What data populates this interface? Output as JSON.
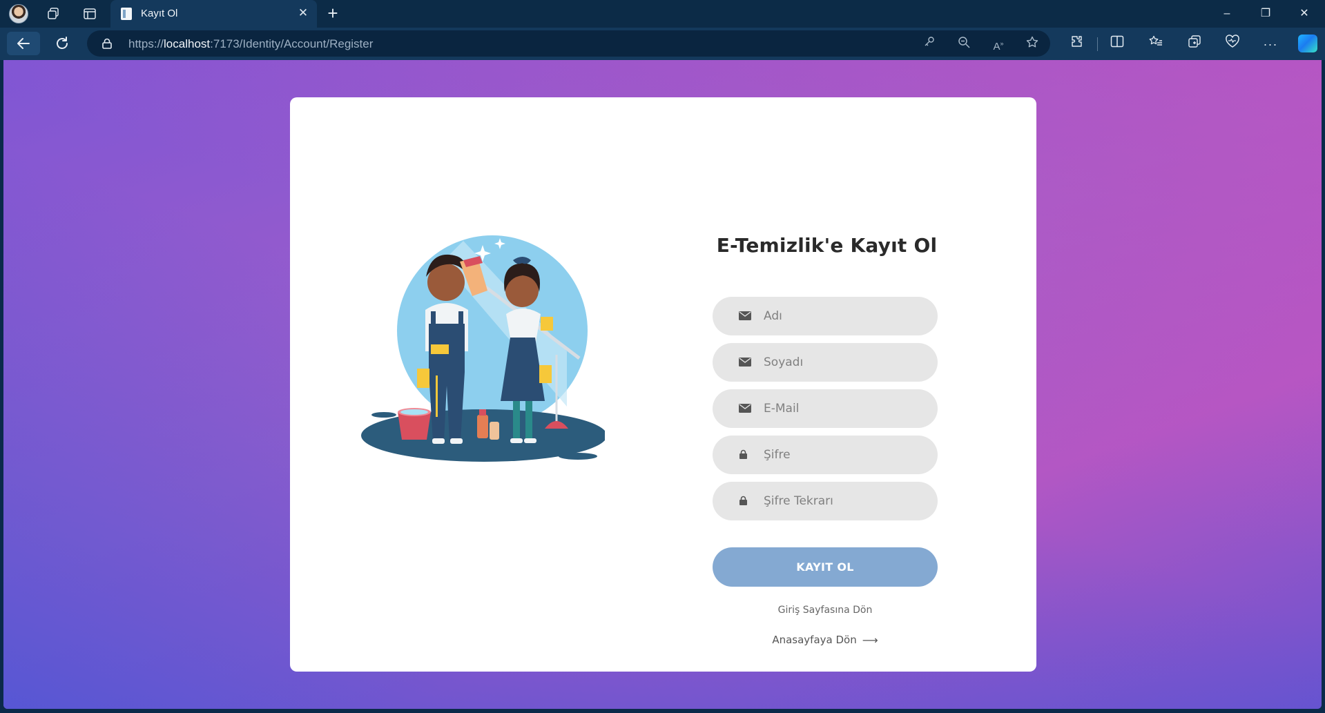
{
  "browser": {
    "tab_title": "Kayıt Ol",
    "tab_close": "✕",
    "new_tab": "+",
    "url": {
      "scheme": "https://",
      "host": "localhost",
      "path": ":7173/Identity/Account/Register"
    },
    "window_controls": {
      "minimize": "–",
      "restore": "❐",
      "close": "✕"
    }
  },
  "page": {
    "title": "E-Temizlik'e Kayıt Ol",
    "fields": {
      "first_name_placeholder": "Adı",
      "last_name_placeholder": "Soyadı",
      "email_placeholder": "E-Mail",
      "password_placeholder": "Şifre",
      "password_confirm_placeholder": "Şifre Tekrarı"
    },
    "submit_label": "KAYIT OL",
    "login_link": "Giriş Sayfasına Dön",
    "home_link": "Anasayfaya Dön",
    "home_arrow": "⟶"
  },
  "colors": {
    "background_gradient_start": "#7f56d4",
    "background_gradient_end": "#b357c4",
    "button": "#84a9d2",
    "field": "#e6e6e6",
    "title": "#2a2a2a"
  }
}
